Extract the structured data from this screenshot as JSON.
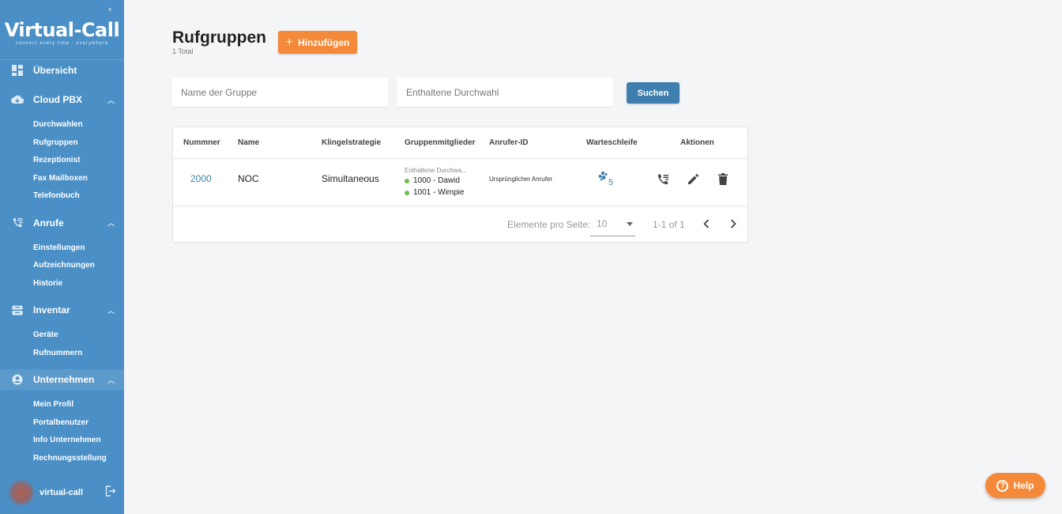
{
  "brand": {
    "name": "Virtual-Call",
    "tagline": "connect every time · everywhere",
    "reg": "®"
  },
  "sidebar": {
    "sections": [
      {
        "label": "Übersicht",
        "icon": "dashboard-icon",
        "items": []
      },
      {
        "label": "Cloud PBX",
        "icon": "cloud-icon",
        "items": [
          "Durchwahlen",
          "Rufgruppen",
          "Rezeptionist",
          "Fax Mailboxen",
          "Telefonbuch"
        ]
      },
      {
        "label": "Anrufe",
        "icon": "phone-list-icon",
        "items": [
          "Einstellungen",
          "Aufzeichnungen",
          "Historie"
        ]
      },
      {
        "label": "Inventar",
        "icon": "inbox-icon",
        "items": [
          "Geräte",
          "Rufnummern"
        ]
      },
      {
        "label": "Unternehmen",
        "icon": "account-circle-icon",
        "items": [
          "Mein Profil",
          "Portalbenutzer",
          "Info Unternehmen",
          "Rechnungsstellung"
        ]
      }
    ],
    "user": {
      "name": "virtual-call"
    }
  },
  "page": {
    "title": "Rufgruppen",
    "subtitle": "1 Total",
    "add_label": "Hinzufügen",
    "search": {
      "group_placeholder": "Name der Gruppe",
      "extension_placeholder": "Enthaltene Durchwahl",
      "button": "Suchen"
    }
  },
  "table": {
    "headers": [
      "Nummner",
      "Name",
      "Klingelstrategie",
      "Gruppenmitglieder",
      "Anrufer-ID",
      "Warteschleife",
      "Aktionen"
    ],
    "rows": [
      {
        "number": "2000",
        "name": "NOC",
        "strategy": "Simultaneous",
        "members_label": "Enthaltene Durchwa...",
        "members": [
          "1000 - Dawid",
          "1001 - Wimpie"
        ],
        "caller_id": "Ursprünglicher Anrufer",
        "queue_count": "5"
      }
    ],
    "pagination": {
      "label": "Elemente pro Seite:",
      "page_size": "10",
      "range": "1-1 of 1"
    }
  },
  "help": {
    "label": "Help"
  },
  "colors": {
    "sidebar": "#4a8fc6",
    "accent": "#f5893a",
    "primary": "#3f7fb0",
    "status_green": "#6bbf4e"
  }
}
